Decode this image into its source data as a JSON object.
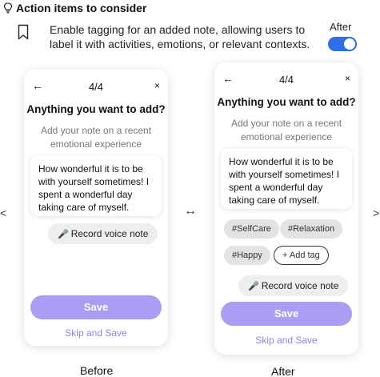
{
  "header": {
    "title": "Action items to consider",
    "description": "Enable tagging for an added note, allowing users to label it with activities, emotions, or relevant contexts.",
    "after_label": "After"
  },
  "before": {
    "back": "←",
    "step": "4/4",
    "close": "×",
    "title": "Anything you want to add?",
    "subtitle": "Add your note on a recent emotional experience",
    "note": "How wonderful it is to be with yourself sometimes! I spent a wonderful day taking care of myself.",
    "voice_label": "Record voice note",
    "save_label": "Save",
    "skip_label": "Skip and Save",
    "caption": "Before"
  },
  "after": {
    "back": "←",
    "step": "4/4",
    "close": "×",
    "title": "Anything you want to add?",
    "subtitle": "Add your note on a recent emotional experience",
    "note": "How wonderful it is to be with yourself sometimes! I spent a wonderful day taking care of myself.",
    "tags": [
      "#SelfCare",
      "#Relaxation",
      "#Happy"
    ],
    "add_tag_label": "+ Add tag",
    "voice_label": "Record voice note",
    "save_label": "Save",
    "skip_label": "Skip and Save",
    "caption": "After"
  },
  "connectors": {
    "middle": "↔",
    "left": "<",
    "right": ">"
  },
  "icons": {
    "header": "lightbulb-icon",
    "feature": "bookmark-icon",
    "voice": "microphone-icon"
  },
  "colors": {
    "primary_button": "#a99df4",
    "skip_link": "#8e84e6",
    "toggle_on": "#2f6ee7",
    "tag_bg": "#e3e3e3"
  }
}
